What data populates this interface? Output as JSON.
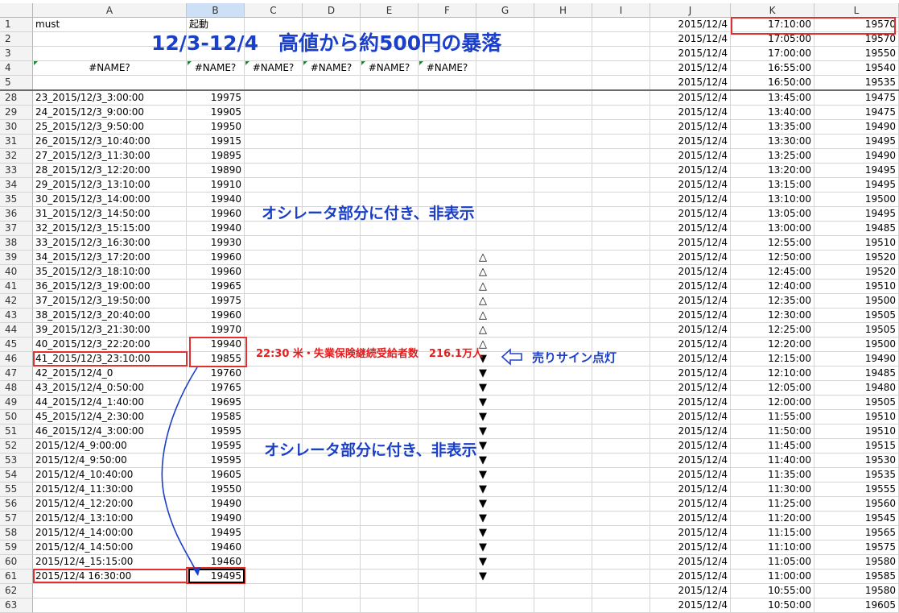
{
  "columns": [
    "A",
    "B",
    "C",
    "D",
    "E",
    "F",
    "G",
    "H",
    "I",
    "J",
    "K",
    "L"
  ],
  "title_overlay": "12/3-12/4　高値から約500円の暴落",
  "oscillator_note": "オシレータ部分に付き、非表示",
  "red_note": "22:30 米・失業保険継続受給者数　216.1万人",
  "signal_label": "売りサイン点灯",
  "top_rows": [
    {
      "num": "1",
      "a": "must",
      "b": "起動",
      "c": "",
      "d": "",
      "e": "",
      "f": "",
      "g": ""
    },
    {
      "num": "2",
      "a": "",
      "b": "",
      "c": "",
      "d": "",
      "e": "",
      "f": "",
      "g": ""
    },
    {
      "num": "3",
      "a": "",
      "b": "",
      "c": "",
      "d": "",
      "e": "",
      "f": "",
      "g": ""
    },
    {
      "num": "4",
      "a": "#NAME?",
      "b": "#NAME?",
      "c": "#NAME?",
      "d": "#NAME?",
      "e": "#NAME?",
      "f": "#NAME?",
      "g": ""
    },
    {
      "num": "5",
      "a": "",
      "b": "",
      "c": "",
      "d": "",
      "e": "",
      "f": "",
      "g": ""
    }
  ],
  "rows": [
    {
      "num": "28",
      "a": "23_2015/12/3_3:00:00",
      "b": "19975",
      "g": ""
    },
    {
      "num": "29",
      "a": "24_2015/12/3_9:00:00",
      "b": "19905",
      "g": ""
    },
    {
      "num": "30",
      "a": "25_2015/12/3_9:50:00",
      "b": "19950",
      "g": ""
    },
    {
      "num": "31",
      "a": "26_2015/12/3_10:40:00",
      "b": "19915",
      "g": ""
    },
    {
      "num": "32",
      "a": "27_2015/12/3_11:30:00",
      "b": "19895",
      "g": ""
    },
    {
      "num": "33",
      "a": "28_2015/12/3_12:20:00",
      "b": "19890",
      "g": ""
    },
    {
      "num": "34",
      "a": "29_2015/12/3_13:10:00",
      "b": "19910",
      "g": ""
    },
    {
      "num": "35",
      "a": "30_2015/12/3_14:00:00",
      "b": "19940",
      "g": ""
    },
    {
      "num": "36",
      "a": "31_2015/12/3_14:50:00",
      "b": "19960",
      "g": ""
    },
    {
      "num": "37",
      "a": "32_2015/12/3_15:15:00",
      "b": "19940",
      "g": ""
    },
    {
      "num": "38",
      "a": "33_2015/12/3_16:30:00",
      "b": "19930",
      "g": ""
    },
    {
      "num": "39",
      "a": "34_2015/12/3_17:20:00",
      "b": "19960",
      "g": "△"
    },
    {
      "num": "40",
      "a": "35_2015/12/3_18:10:00",
      "b": "19960",
      "g": "△"
    },
    {
      "num": "41",
      "a": "36_2015/12/3_19:00:00",
      "b": "19965",
      "g": "△"
    },
    {
      "num": "42",
      "a": "37_2015/12/3_19:50:00",
      "b": "19975",
      "g": "△"
    },
    {
      "num": "43",
      "a": "38_2015/12/3_20:40:00",
      "b": "19960",
      "g": "△"
    },
    {
      "num": "44",
      "a": "39_2015/12/3_21:30:00",
      "b": "19970",
      "g": "△"
    },
    {
      "num": "45",
      "a": "40_2015/12/3_22:20:00",
      "b": "19940",
      "g": "△"
    },
    {
      "num": "46",
      "a": "41_2015/12/3_23:10:00",
      "b": "19855",
      "g": "▼"
    },
    {
      "num": "47",
      "a": "42_2015/12/4_0",
      "b": "19760",
      "g": "▼"
    },
    {
      "num": "48",
      "a": "43_2015/12/4_0:50:00",
      "b": "19765",
      "g": "▼"
    },
    {
      "num": "49",
      "a": "44_2015/12/4_1:40:00",
      "b": "19695",
      "g": "▼"
    },
    {
      "num": "50",
      "a": "45_2015/12/4_2:30:00",
      "b": "19585",
      "g": "▼"
    },
    {
      "num": "51",
      "a": "46_2015/12/4_3:00:00",
      "b": "19595",
      "g": "▼"
    },
    {
      "num": "52",
      "a": "2015/12/4_9:00:00",
      "b": "19595",
      "g": "▼"
    },
    {
      "num": "53",
      "a": "2015/12/4_9:50:00",
      "b": "19595",
      "g": "▼"
    },
    {
      "num": "54",
      "a": "2015/12/4_10:40:00",
      "b": "19605",
      "g": "▼"
    },
    {
      "num": "55",
      "a": "2015/12/4_11:30:00",
      "b": "19550",
      "g": "▼"
    },
    {
      "num": "56",
      "a": "2015/12/4_12:20:00",
      "b": "19490",
      "g": "▼"
    },
    {
      "num": "57",
      "a": "2015/12/4_13:10:00",
      "b": "19490",
      "g": "▼"
    },
    {
      "num": "58",
      "a": "2015/12/4_14:00:00",
      "b": "19495",
      "g": "▼"
    },
    {
      "num": "59",
      "a": "2015/12/4_14:50:00",
      "b": "19460",
      "g": "▼"
    },
    {
      "num": "60",
      "a": "2015/12/4_15:15:00",
      "b": "19460",
      "g": "▼"
    },
    {
      "num": "61",
      "a": "2015/12/4 16:30:00",
      "b": "19495",
      "g": "▼"
    },
    {
      "num": "62",
      "a": "",
      "b": "",
      "g": ""
    },
    {
      "num": "63",
      "a": "",
      "b": "",
      "g": ""
    }
  ],
  "right_rows": [
    {
      "j": "2015/12/4",
      "k": "17:10:00",
      "l": "19570"
    },
    {
      "j": "2015/12/4",
      "k": "17:05:00",
      "l": "19570"
    },
    {
      "j": "2015/12/4",
      "k": "17:00:00",
      "l": "19550"
    },
    {
      "j": "2015/12/4",
      "k": "16:55:00",
      "l": "19540"
    },
    {
      "j": "2015/12/4",
      "k": "16:50:00",
      "l": "19535"
    },
    {
      "j": "2015/12/4",
      "k": "13:45:00",
      "l": "19475"
    },
    {
      "j": "2015/12/4",
      "k": "13:40:00",
      "l": "19475"
    },
    {
      "j": "2015/12/4",
      "k": "13:35:00",
      "l": "19490"
    },
    {
      "j": "2015/12/4",
      "k": "13:30:00",
      "l": "19495"
    },
    {
      "j": "2015/12/4",
      "k": "13:25:00",
      "l": "19490"
    },
    {
      "j": "2015/12/4",
      "k": "13:20:00",
      "l": "19495"
    },
    {
      "j": "2015/12/4",
      "k": "13:15:00",
      "l": "19495"
    },
    {
      "j": "2015/12/4",
      "k": "13:10:00",
      "l": "19500"
    },
    {
      "j": "2015/12/4",
      "k": "13:05:00",
      "l": "19495"
    },
    {
      "j": "2015/12/4",
      "k": "13:00:00",
      "l": "19485"
    },
    {
      "j": "2015/12/4",
      "k": "12:55:00",
      "l": "19510"
    },
    {
      "j": "2015/12/4",
      "k": "12:50:00",
      "l": "19520"
    },
    {
      "j": "2015/12/4",
      "k": "12:45:00",
      "l": "19520"
    },
    {
      "j": "2015/12/4",
      "k": "12:40:00",
      "l": "19510"
    },
    {
      "j": "2015/12/4",
      "k": "12:35:00",
      "l": "19500"
    },
    {
      "j": "2015/12/4",
      "k": "12:30:00",
      "l": "19505"
    },
    {
      "j": "2015/12/4",
      "k": "12:25:00",
      "l": "19505"
    },
    {
      "j": "2015/12/4",
      "k": "12:20:00",
      "l": "19500"
    },
    {
      "j": "2015/12/4",
      "k": "12:15:00",
      "l": "19490"
    },
    {
      "j": "2015/12/4",
      "k": "12:10:00",
      "l": "19485"
    },
    {
      "j": "2015/12/4",
      "k": "12:05:00",
      "l": "19480"
    },
    {
      "j": "2015/12/4",
      "k": "12:00:00",
      "l": "19505"
    },
    {
      "j": "2015/12/4",
      "k": "11:55:00",
      "l": "19510"
    },
    {
      "j": "2015/12/4",
      "k": "11:50:00",
      "l": "19510"
    },
    {
      "j": "2015/12/4",
      "k": "11:45:00",
      "l": "19515"
    },
    {
      "j": "2015/12/4",
      "k": "11:40:00",
      "l": "19530"
    },
    {
      "j": "2015/12/4",
      "k": "11:35:00",
      "l": "19535"
    },
    {
      "j": "2015/12/4",
      "k": "11:30:00",
      "l": "19555"
    },
    {
      "j": "2015/12/4",
      "k": "11:25:00",
      "l": "19560"
    },
    {
      "j": "2015/12/4",
      "k": "11:20:00",
      "l": "19545"
    },
    {
      "j": "2015/12/4",
      "k": "11:15:00",
      "l": "19565"
    },
    {
      "j": "2015/12/4",
      "k": "11:10:00",
      "l": "19575"
    },
    {
      "j": "2015/12/4",
      "k": "11:05:00",
      "l": "19580"
    },
    {
      "j": "2015/12/4",
      "k": "11:00:00",
      "l": "19585"
    },
    {
      "j": "2015/12/4",
      "k": "10:55:00",
      "l": "19580"
    },
    {
      "j": "2015/12/4",
      "k": "10:50:00",
      "l": "19605"
    }
  ],
  "colors": {
    "annotation_blue": "#1a3fc8",
    "annotation_red": "#e02020",
    "highlight_box": "#e03030",
    "error_tag": "#1a8a2e"
  }
}
